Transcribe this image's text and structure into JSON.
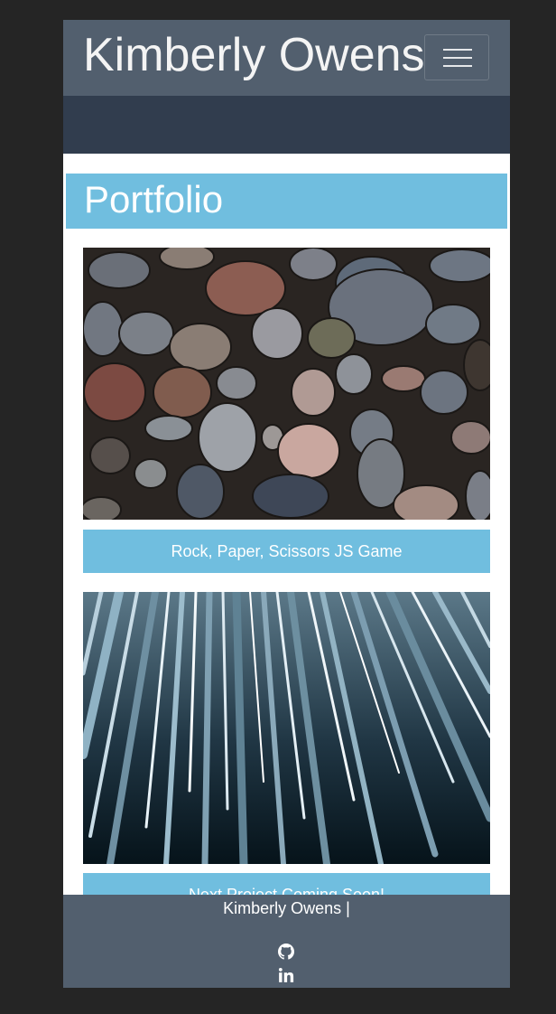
{
  "navbar": {
    "brand": "Kimberly Owens",
    "toggler_icon": "hamburger-menu-icon"
  },
  "portfolio": {
    "title": "Portfolio",
    "projects": [
      {
        "caption": "Rock, Paper, Scissors JS Game",
        "image": "rocks-photo"
      },
      {
        "caption": "Next Project Coming Soon!",
        "image": "light-streaks-photo"
      }
    ]
  },
  "footer": {
    "text": "Kimberly Owens |",
    "icons": [
      "github-icon",
      "linkedin-icon"
    ]
  },
  "colors": {
    "page_background": "#252525",
    "navbar": "#525f6e",
    "subbar": "#313d4e",
    "accent": "#70bedf",
    "footer": "#525f6e"
  }
}
